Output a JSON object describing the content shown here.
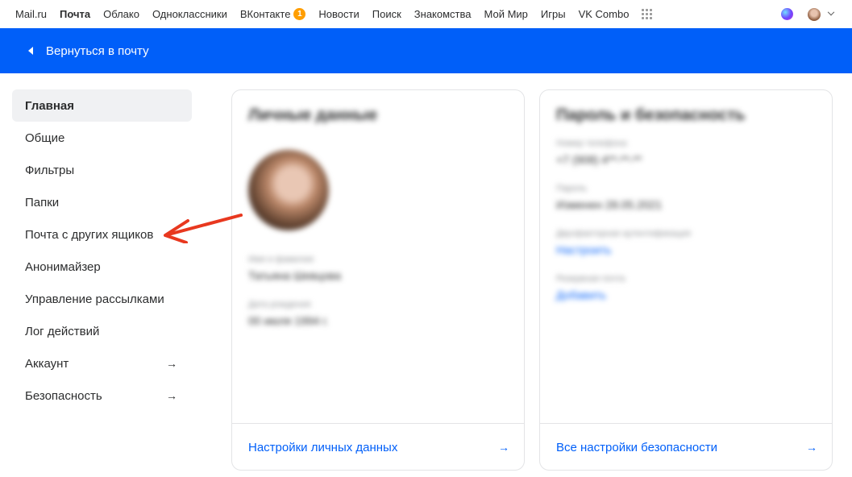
{
  "portal": {
    "links": [
      {
        "label": "Mail.ru"
      },
      {
        "label": "Почта",
        "active": true
      },
      {
        "label": "Облако"
      },
      {
        "label": "Одноклассники"
      },
      {
        "label": "ВКонтакте",
        "badge": "1"
      },
      {
        "label": "Новости"
      },
      {
        "label": "Поиск"
      },
      {
        "label": "Знакомства"
      },
      {
        "label": "Мой Мир"
      },
      {
        "label": "Игры"
      },
      {
        "label": "VK Combo"
      }
    ],
    "apps_icon": "grid-icon"
  },
  "header": {
    "back_label": "Вернуться в почту",
    "bar_color": "#005ff9"
  },
  "sidebar": {
    "items": [
      {
        "label": "Главная",
        "active": true
      },
      {
        "label": "Общие"
      },
      {
        "label": "Фильтры"
      },
      {
        "label": "Папки"
      },
      {
        "label": "Почта с других ящиков"
      },
      {
        "label": "Анонимайзер"
      },
      {
        "label": "Управление рассылками"
      },
      {
        "label": "Лог действий"
      },
      {
        "label": "Аккаунт",
        "arrow": "→"
      },
      {
        "label": "Безопасность",
        "arrow": "→"
      }
    ]
  },
  "annotation": {
    "color": "#e8381f",
    "icon": "red-arrow"
  },
  "personal_card": {
    "title": "Личные данные",
    "name_label": "Имя и фамилия",
    "name_value": "Татьяна Шевцова",
    "birthday_label": "Дата рождения",
    "birthday_value": "00 июля 1994 г.",
    "footer_link": "Настройки личных данных",
    "footer_arrow": "→"
  },
  "security_card": {
    "title": "Пароль и безопасность",
    "phone_label": "Номер телефона",
    "phone_value": "+7 (908) 4**-**-**",
    "password_label": "Пароль",
    "password_value": "Изменен 28.05.2021",
    "twofa_label": "Двухфакторная аутентификация",
    "twofa_link": "Настроить",
    "backup_label": "Резервная почта",
    "backup_link": "Добавить",
    "footer_link": "Все настройки безопасности",
    "footer_arrow": "→"
  }
}
